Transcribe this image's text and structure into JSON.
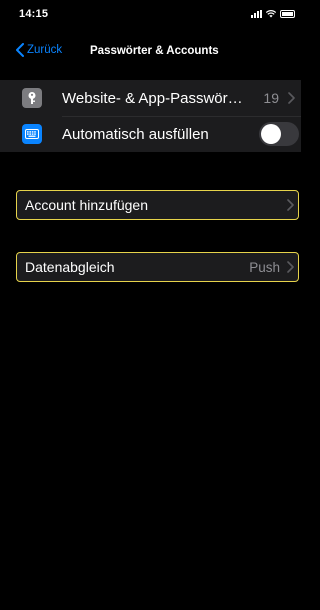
{
  "status": {
    "time": "14:15"
  },
  "nav": {
    "back_label": "Zurück",
    "title": "Passwörter & Accounts"
  },
  "rows": [
    {
      "label": "Website- & App-Passwör…",
      "detail": "19",
      "icon": "key-icon"
    },
    {
      "label": "Automatisch ausfüllen",
      "toggle": "off",
      "icon": "keyboard-icon"
    }
  ],
  "add_account": {
    "label": "Account hinzufügen"
  },
  "data_sync": {
    "label": "Datenabgleich",
    "value": "Push"
  },
  "colors": {
    "accent": "#0a84ff",
    "highlight": "#e6d34b",
    "cell": "#1c1c1e"
  }
}
